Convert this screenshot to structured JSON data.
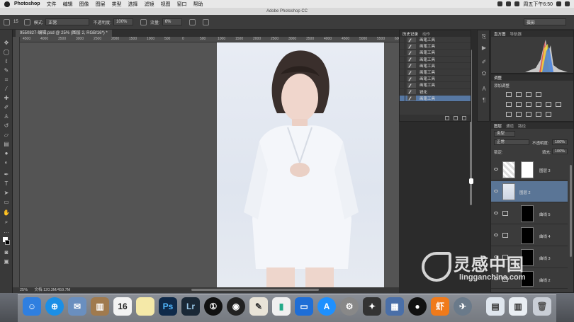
{
  "menubar": {
    "app": "Photoshop",
    "items": [
      "文件",
      "编辑",
      "图像",
      "图层",
      "类型",
      "选择",
      "滤镜",
      "视图",
      "窗口",
      "帮助"
    ],
    "clock": "周五下午6:50"
  },
  "window_title": "Adobe Photoshop CC",
  "options": {
    "brush_size": "15",
    "mode_label": "模式:",
    "mode_value": "正常",
    "opacity_label": "不透明度:",
    "opacity_value": "100%",
    "flow_label": "流量:",
    "flow_value": "6%",
    "workspace": "摄影"
  },
  "document": {
    "tab": "9550827-编辑.psd @ 25% (图层 2, RGB/16*) *",
    "ruler": [
      "4500",
      "4000",
      "3500",
      "3000",
      "2500",
      "2000",
      "1500",
      "1000",
      "500",
      "0",
      "500",
      "1000",
      "1500",
      "2000",
      "2500",
      "3000",
      "3500",
      "4000",
      "4500",
      "5000",
      "5500",
      "6000"
    ]
  },
  "status": {
    "zoom": "25%",
    "doc": "文档:120.3M/459.7M"
  },
  "history": {
    "tabs": [
      "历史记录",
      "动作"
    ],
    "rows": [
      "画笔工具",
      "画笔工具",
      "画笔工具",
      "画笔工具",
      "画笔工具",
      "画笔工具",
      "画笔工具",
      "画笔工具",
      "锐化",
      "画笔工具"
    ],
    "selected": 9
  },
  "histogram": {
    "tabs": [
      "直方图",
      "导航器"
    ]
  },
  "adjustments": {
    "title": "调整",
    "add": "添加调整"
  },
  "layers": {
    "tabs": [
      "图层",
      "通道",
      "路径"
    ],
    "kind": "类型",
    "blend": "正常",
    "opacity_label": "不透明度:",
    "opacity": "100%",
    "lock_label": "锁定:",
    "fill_label": "填充:",
    "fill": "100%",
    "rows": [
      {
        "name": "图层 3"
      },
      {
        "name": "图层 2"
      },
      {
        "name": "曲线 5"
      },
      {
        "name": "曲线 4"
      },
      {
        "name": "曲线 3"
      },
      {
        "name": "曲线 2"
      }
    ]
  },
  "watermark": {
    "brand": "灵感中国",
    "url": "lingganchina.com"
  },
  "dock": {
    "calendar_day": "16",
    "ps": "Ps",
    "lr": "Lr"
  }
}
